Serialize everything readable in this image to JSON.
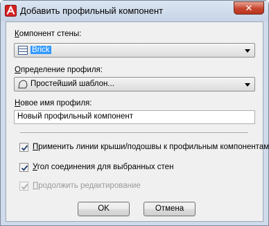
{
  "window": {
    "title": "Добавить профильный компонент",
    "close_label": "✕"
  },
  "wall_component": {
    "label_accel": "К",
    "label_rest": "омпонент стены:",
    "value": "Brick",
    "icon": "wall-component-icon"
  },
  "profile_definition": {
    "label_accel": "О",
    "label_rest": "пределение профиля:",
    "value": "Простейший шаблон...",
    "icon": "profile-shape-icon"
  },
  "new_profile_name": {
    "label_accel": "Н",
    "label_rest": "овое имя профиля:",
    "value": "Новый профильный компонент"
  },
  "checkboxes": [
    {
      "accel": "П",
      "rest": "рименить линии крыши/подошвы к профильным компонентам",
      "checked": true,
      "enabled": true
    },
    {
      "accel": "У",
      "rest": "гол соединения для выбранных стен",
      "checked": true,
      "enabled": true
    },
    {
      "accel": "П",
      "rest": "родолжить редактирование",
      "checked": true,
      "enabled": false
    }
  ],
  "buttons": {
    "ok": "OK",
    "cancel": "Отмена"
  },
  "colors": {
    "selection": "#3399ff",
    "close_button": "#c7452f",
    "frame": "#cfdbea"
  }
}
